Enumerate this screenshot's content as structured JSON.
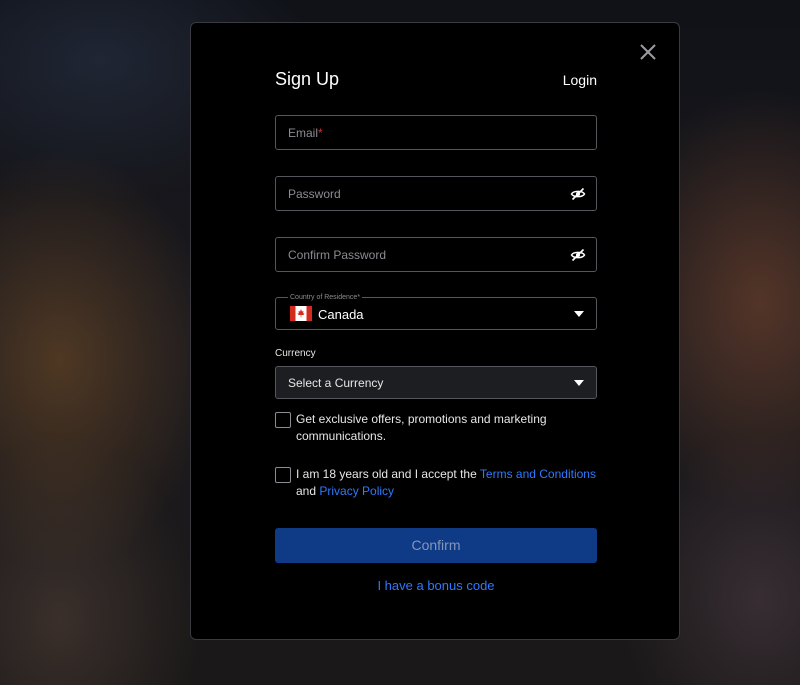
{
  "modal": {
    "title": "Sign Up",
    "login_label": "Login"
  },
  "fields": {
    "email": {
      "placeholder": "Email",
      "required_mark": "*"
    },
    "password": {
      "placeholder": "Password"
    },
    "confirm_password": {
      "placeholder": "Confirm Password"
    }
  },
  "country": {
    "label": "Country of Residence*",
    "value": "Canada",
    "flag_icon": "canada-flag-icon"
  },
  "currency": {
    "label": "Currency",
    "value": "Select a Currency"
  },
  "consents": {
    "marketing_text": "Get exclusive offers, promotions and marketing communications.",
    "age_text_prefix": "I am 18 years old and I accept the",
    "terms_link": "Terms and Conditions",
    "and_text": "and",
    "privacy_link": "Privacy Policy"
  },
  "actions": {
    "confirm_label": "Confirm",
    "bonus_label": "I have a bonus code"
  },
  "colors": {
    "accent": "#2f78ff",
    "confirm_bg": "#0e3a86",
    "required": "#e0312f"
  },
  "icons": {
    "close": "close-icon",
    "password_toggle": "eye-off-icon",
    "dropdown": "caret-down-icon"
  }
}
